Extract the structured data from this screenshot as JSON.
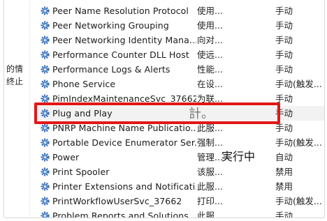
{
  "left_panel": {
    "line1": "的情",
    "line2": "终止"
  },
  "services": [
    {
      "name": "Peer Name Resolution Protocol",
      "description": "使用...",
      "status": "",
      "startup": "手动"
    },
    {
      "name": "Peer Networking Grouping",
      "description": "使用...",
      "status": "",
      "startup": "手动"
    },
    {
      "name": "Peer Networking Identity Mana...",
      "description": "向对...",
      "status": "",
      "startup": "手动"
    },
    {
      "name": "Performance Counter DLL Host",
      "description": "使远...",
      "status": "",
      "startup": "手动"
    },
    {
      "name": "Performance Logs & Alerts",
      "description": "性能...",
      "status": "",
      "startup": "手动"
    },
    {
      "name": "Phone Service",
      "description": "在设...",
      "status": "",
      "startup": "手动(触发..."
    },
    {
      "name": "PimIndexMaintenanceSvc_37662",
      "description": "为联...",
      "status": "",
      "startup": "手动"
    },
    {
      "name": "Plug and Play",
      "description": "",
      "status": "",
      "startup": "手动"
    },
    {
      "name": "PNRP Machine Name Publicatio...",
      "description": "此服...",
      "status": "",
      "startup": "手动"
    },
    {
      "name": "Portable Device Enumerator Ser...",
      "description": "强制...",
      "status": "",
      "startup": "手动(触发..."
    },
    {
      "name": "Power",
      "description": "管理...",
      "status": "",
      "startup": "自动"
    },
    {
      "name": "Print Spooler",
      "description": "该服...",
      "status": "",
      "startup": "禁用"
    },
    {
      "name": "Printer Extensions and Notificati...",
      "description": "此服...",
      "status": "",
      "startup": "禁用"
    },
    {
      "name": "PrintWorkflowUserSvc_37662",
      "description": "打印...",
      "status": "",
      "startup": "手动(触发..."
    },
    {
      "name": "Problem Reports and Solutions ...",
      "description": "此服...",
      "status": "",
      "startup": "手动"
    }
  ],
  "overlays": {
    "plug_desc_fragment": "計。",
    "power_status": "実行中"
  },
  "colors": {
    "highlight_border": "#e11717",
    "selected_row_bg": "#f2f2f2",
    "gear_icon": "#3b6fb6"
  }
}
